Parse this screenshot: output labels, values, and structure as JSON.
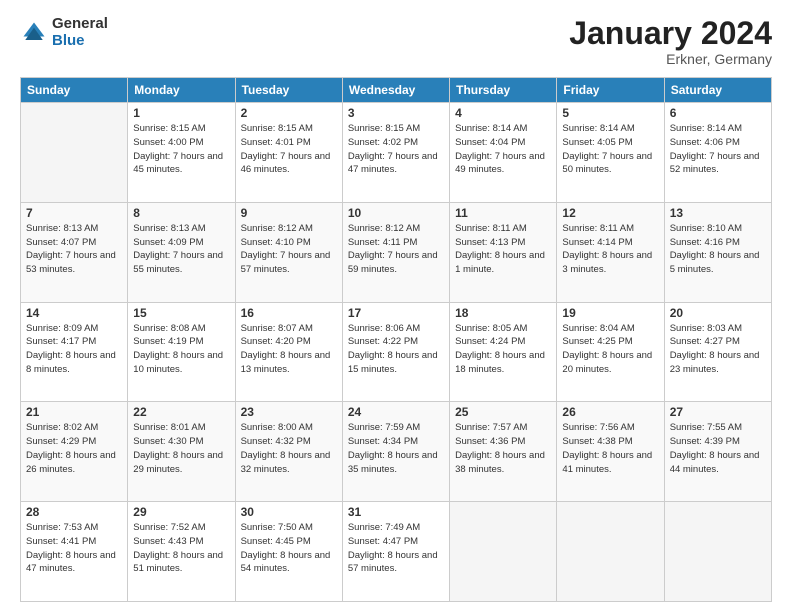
{
  "logo": {
    "general": "General",
    "blue": "Blue"
  },
  "header": {
    "title": "January 2024",
    "location": "Erkner, Germany"
  },
  "weekdays": [
    "Sunday",
    "Monday",
    "Tuesday",
    "Wednesday",
    "Thursday",
    "Friday",
    "Saturday"
  ],
  "weeks": [
    [
      {
        "day": "",
        "sunrise": "",
        "sunset": "",
        "daylight": ""
      },
      {
        "day": "1",
        "sunrise": "Sunrise: 8:15 AM",
        "sunset": "Sunset: 4:00 PM",
        "daylight": "Daylight: 7 hours and 45 minutes."
      },
      {
        "day": "2",
        "sunrise": "Sunrise: 8:15 AM",
        "sunset": "Sunset: 4:01 PM",
        "daylight": "Daylight: 7 hours and 46 minutes."
      },
      {
        "day": "3",
        "sunrise": "Sunrise: 8:15 AM",
        "sunset": "Sunset: 4:02 PM",
        "daylight": "Daylight: 7 hours and 47 minutes."
      },
      {
        "day": "4",
        "sunrise": "Sunrise: 8:14 AM",
        "sunset": "Sunset: 4:04 PM",
        "daylight": "Daylight: 7 hours and 49 minutes."
      },
      {
        "day": "5",
        "sunrise": "Sunrise: 8:14 AM",
        "sunset": "Sunset: 4:05 PM",
        "daylight": "Daylight: 7 hours and 50 minutes."
      },
      {
        "day": "6",
        "sunrise": "Sunrise: 8:14 AM",
        "sunset": "Sunset: 4:06 PM",
        "daylight": "Daylight: 7 hours and 52 minutes."
      }
    ],
    [
      {
        "day": "7",
        "sunrise": "Sunrise: 8:13 AM",
        "sunset": "Sunset: 4:07 PM",
        "daylight": "Daylight: 7 hours and 53 minutes."
      },
      {
        "day": "8",
        "sunrise": "Sunrise: 8:13 AM",
        "sunset": "Sunset: 4:09 PM",
        "daylight": "Daylight: 7 hours and 55 minutes."
      },
      {
        "day": "9",
        "sunrise": "Sunrise: 8:12 AM",
        "sunset": "Sunset: 4:10 PM",
        "daylight": "Daylight: 7 hours and 57 minutes."
      },
      {
        "day": "10",
        "sunrise": "Sunrise: 8:12 AM",
        "sunset": "Sunset: 4:11 PM",
        "daylight": "Daylight: 7 hours and 59 minutes."
      },
      {
        "day": "11",
        "sunrise": "Sunrise: 8:11 AM",
        "sunset": "Sunset: 4:13 PM",
        "daylight": "Daylight: 8 hours and 1 minute."
      },
      {
        "day": "12",
        "sunrise": "Sunrise: 8:11 AM",
        "sunset": "Sunset: 4:14 PM",
        "daylight": "Daylight: 8 hours and 3 minutes."
      },
      {
        "day": "13",
        "sunrise": "Sunrise: 8:10 AM",
        "sunset": "Sunset: 4:16 PM",
        "daylight": "Daylight: 8 hours and 5 minutes."
      }
    ],
    [
      {
        "day": "14",
        "sunrise": "Sunrise: 8:09 AM",
        "sunset": "Sunset: 4:17 PM",
        "daylight": "Daylight: 8 hours and 8 minutes."
      },
      {
        "day": "15",
        "sunrise": "Sunrise: 8:08 AM",
        "sunset": "Sunset: 4:19 PM",
        "daylight": "Daylight: 8 hours and 10 minutes."
      },
      {
        "day": "16",
        "sunrise": "Sunrise: 8:07 AM",
        "sunset": "Sunset: 4:20 PM",
        "daylight": "Daylight: 8 hours and 13 minutes."
      },
      {
        "day": "17",
        "sunrise": "Sunrise: 8:06 AM",
        "sunset": "Sunset: 4:22 PM",
        "daylight": "Daylight: 8 hours and 15 minutes."
      },
      {
        "day": "18",
        "sunrise": "Sunrise: 8:05 AM",
        "sunset": "Sunset: 4:24 PM",
        "daylight": "Daylight: 8 hours and 18 minutes."
      },
      {
        "day": "19",
        "sunrise": "Sunrise: 8:04 AM",
        "sunset": "Sunset: 4:25 PM",
        "daylight": "Daylight: 8 hours and 20 minutes."
      },
      {
        "day": "20",
        "sunrise": "Sunrise: 8:03 AM",
        "sunset": "Sunset: 4:27 PM",
        "daylight": "Daylight: 8 hours and 23 minutes."
      }
    ],
    [
      {
        "day": "21",
        "sunrise": "Sunrise: 8:02 AM",
        "sunset": "Sunset: 4:29 PM",
        "daylight": "Daylight: 8 hours and 26 minutes."
      },
      {
        "day": "22",
        "sunrise": "Sunrise: 8:01 AM",
        "sunset": "Sunset: 4:30 PM",
        "daylight": "Daylight: 8 hours and 29 minutes."
      },
      {
        "day": "23",
        "sunrise": "Sunrise: 8:00 AM",
        "sunset": "Sunset: 4:32 PM",
        "daylight": "Daylight: 8 hours and 32 minutes."
      },
      {
        "day": "24",
        "sunrise": "Sunrise: 7:59 AM",
        "sunset": "Sunset: 4:34 PM",
        "daylight": "Daylight: 8 hours and 35 minutes."
      },
      {
        "day": "25",
        "sunrise": "Sunrise: 7:57 AM",
        "sunset": "Sunset: 4:36 PM",
        "daylight": "Daylight: 8 hours and 38 minutes."
      },
      {
        "day": "26",
        "sunrise": "Sunrise: 7:56 AM",
        "sunset": "Sunset: 4:38 PM",
        "daylight": "Daylight: 8 hours and 41 minutes."
      },
      {
        "day": "27",
        "sunrise": "Sunrise: 7:55 AM",
        "sunset": "Sunset: 4:39 PM",
        "daylight": "Daylight: 8 hours and 44 minutes."
      }
    ],
    [
      {
        "day": "28",
        "sunrise": "Sunrise: 7:53 AM",
        "sunset": "Sunset: 4:41 PM",
        "daylight": "Daylight: 8 hours and 47 minutes."
      },
      {
        "day": "29",
        "sunrise": "Sunrise: 7:52 AM",
        "sunset": "Sunset: 4:43 PM",
        "daylight": "Daylight: 8 hours and 51 minutes."
      },
      {
        "day": "30",
        "sunrise": "Sunrise: 7:50 AM",
        "sunset": "Sunset: 4:45 PM",
        "daylight": "Daylight: 8 hours and 54 minutes."
      },
      {
        "day": "31",
        "sunrise": "Sunrise: 7:49 AM",
        "sunset": "Sunset: 4:47 PM",
        "daylight": "Daylight: 8 hours and 57 minutes."
      },
      {
        "day": "",
        "sunrise": "",
        "sunset": "",
        "daylight": ""
      },
      {
        "day": "",
        "sunrise": "",
        "sunset": "",
        "daylight": ""
      },
      {
        "day": "",
        "sunrise": "",
        "sunset": "",
        "daylight": ""
      }
    ]
  ]
}
